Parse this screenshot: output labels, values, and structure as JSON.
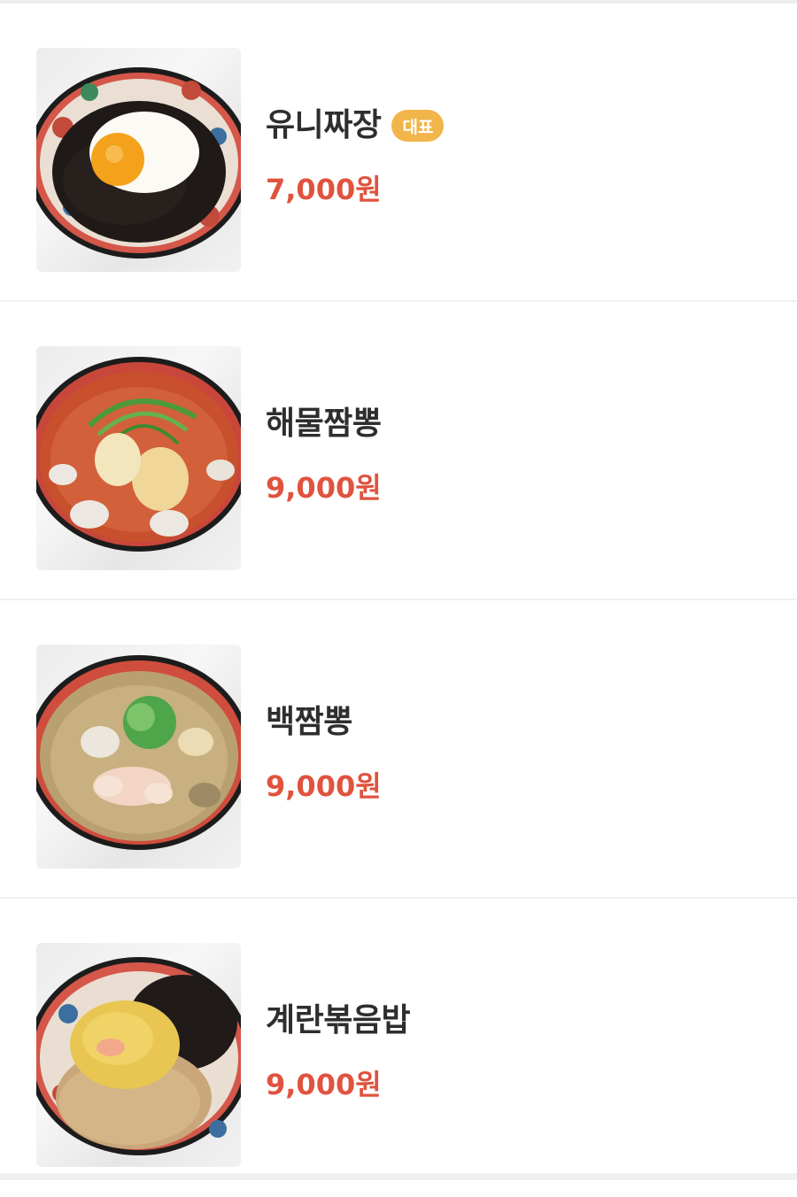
{
  "menu": {
    "items": [
      {
        "name": "유니짜장",
        "badge": "대표",
        "price": "7,000원",
        "image_icon": "jajangmyeon-photo"
      },
      {
        "name": "해물짬뽕",
        "badge": "",
        "price": "9,000원",
        "image_icon": "seafood-jjamppong-photo"
      },
      {
        "name": "백짬뽕",
        "badge": "",
        "price": "9,000원",
        "image_icon": "white-jjamppong-photo"
      },
      {
        "name": "계란볶음밥",
        "badge": "",
        "price": "9,000원",
        "image_icon": "egg-fried-rice-photo"
      }
    ]
  },
  "colors": {
    "price": "#e0533e",
    "badge_bg": "#f1b54a",
    "name_text": "#2e2e2e",
    "divider": "#f0f0f0"
  }
}
